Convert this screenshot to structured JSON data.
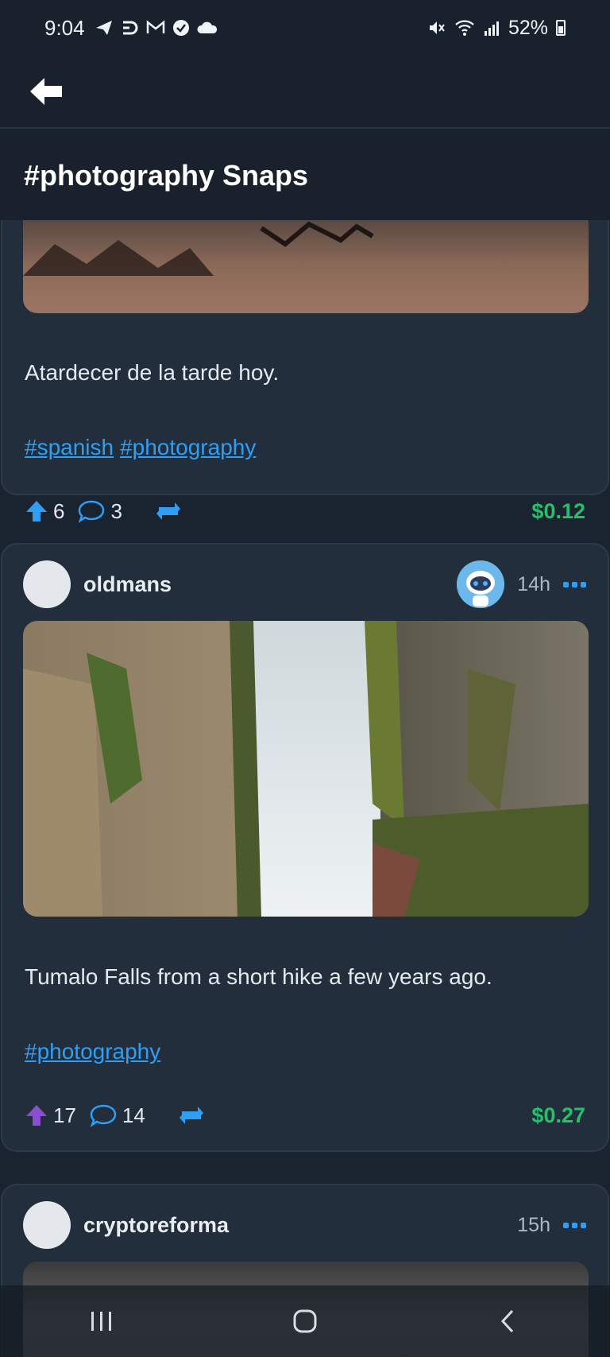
{
  "status_bar": {
    "time": "9:04",
    "battery": "52%"
  },
  "page": {
    "title": "#photography Snaps"
  },
  "posts": [
    {
      "text": "Atardecer de la tarde hoy.",
      "tags": [
        "#spanish",
        "#photography"
      ],
      "upvotes": "6",
      "comments": "3",
      "payout": "$0.12"
    },
    {
      "author": "oldmans",
      "time": "14h",
      "text": "Tumalo Falls from a short hike a few years ago.",
      "tags": [
        "#photography"
      ],
      "upvotes": "17",
      "comments": "14",
      "payout": "$0.27"
    },
    {
      "author": "cryptoreforma",
      "time": "15h"
    }
  ],
  "colors": {
    "accent": "#2f9ef5",
    "payout": "#27c06a",
    "upvoted": "#8a4fd1",
    "card": "#222e3c",
    "background": "#1a2430"
  }
}
